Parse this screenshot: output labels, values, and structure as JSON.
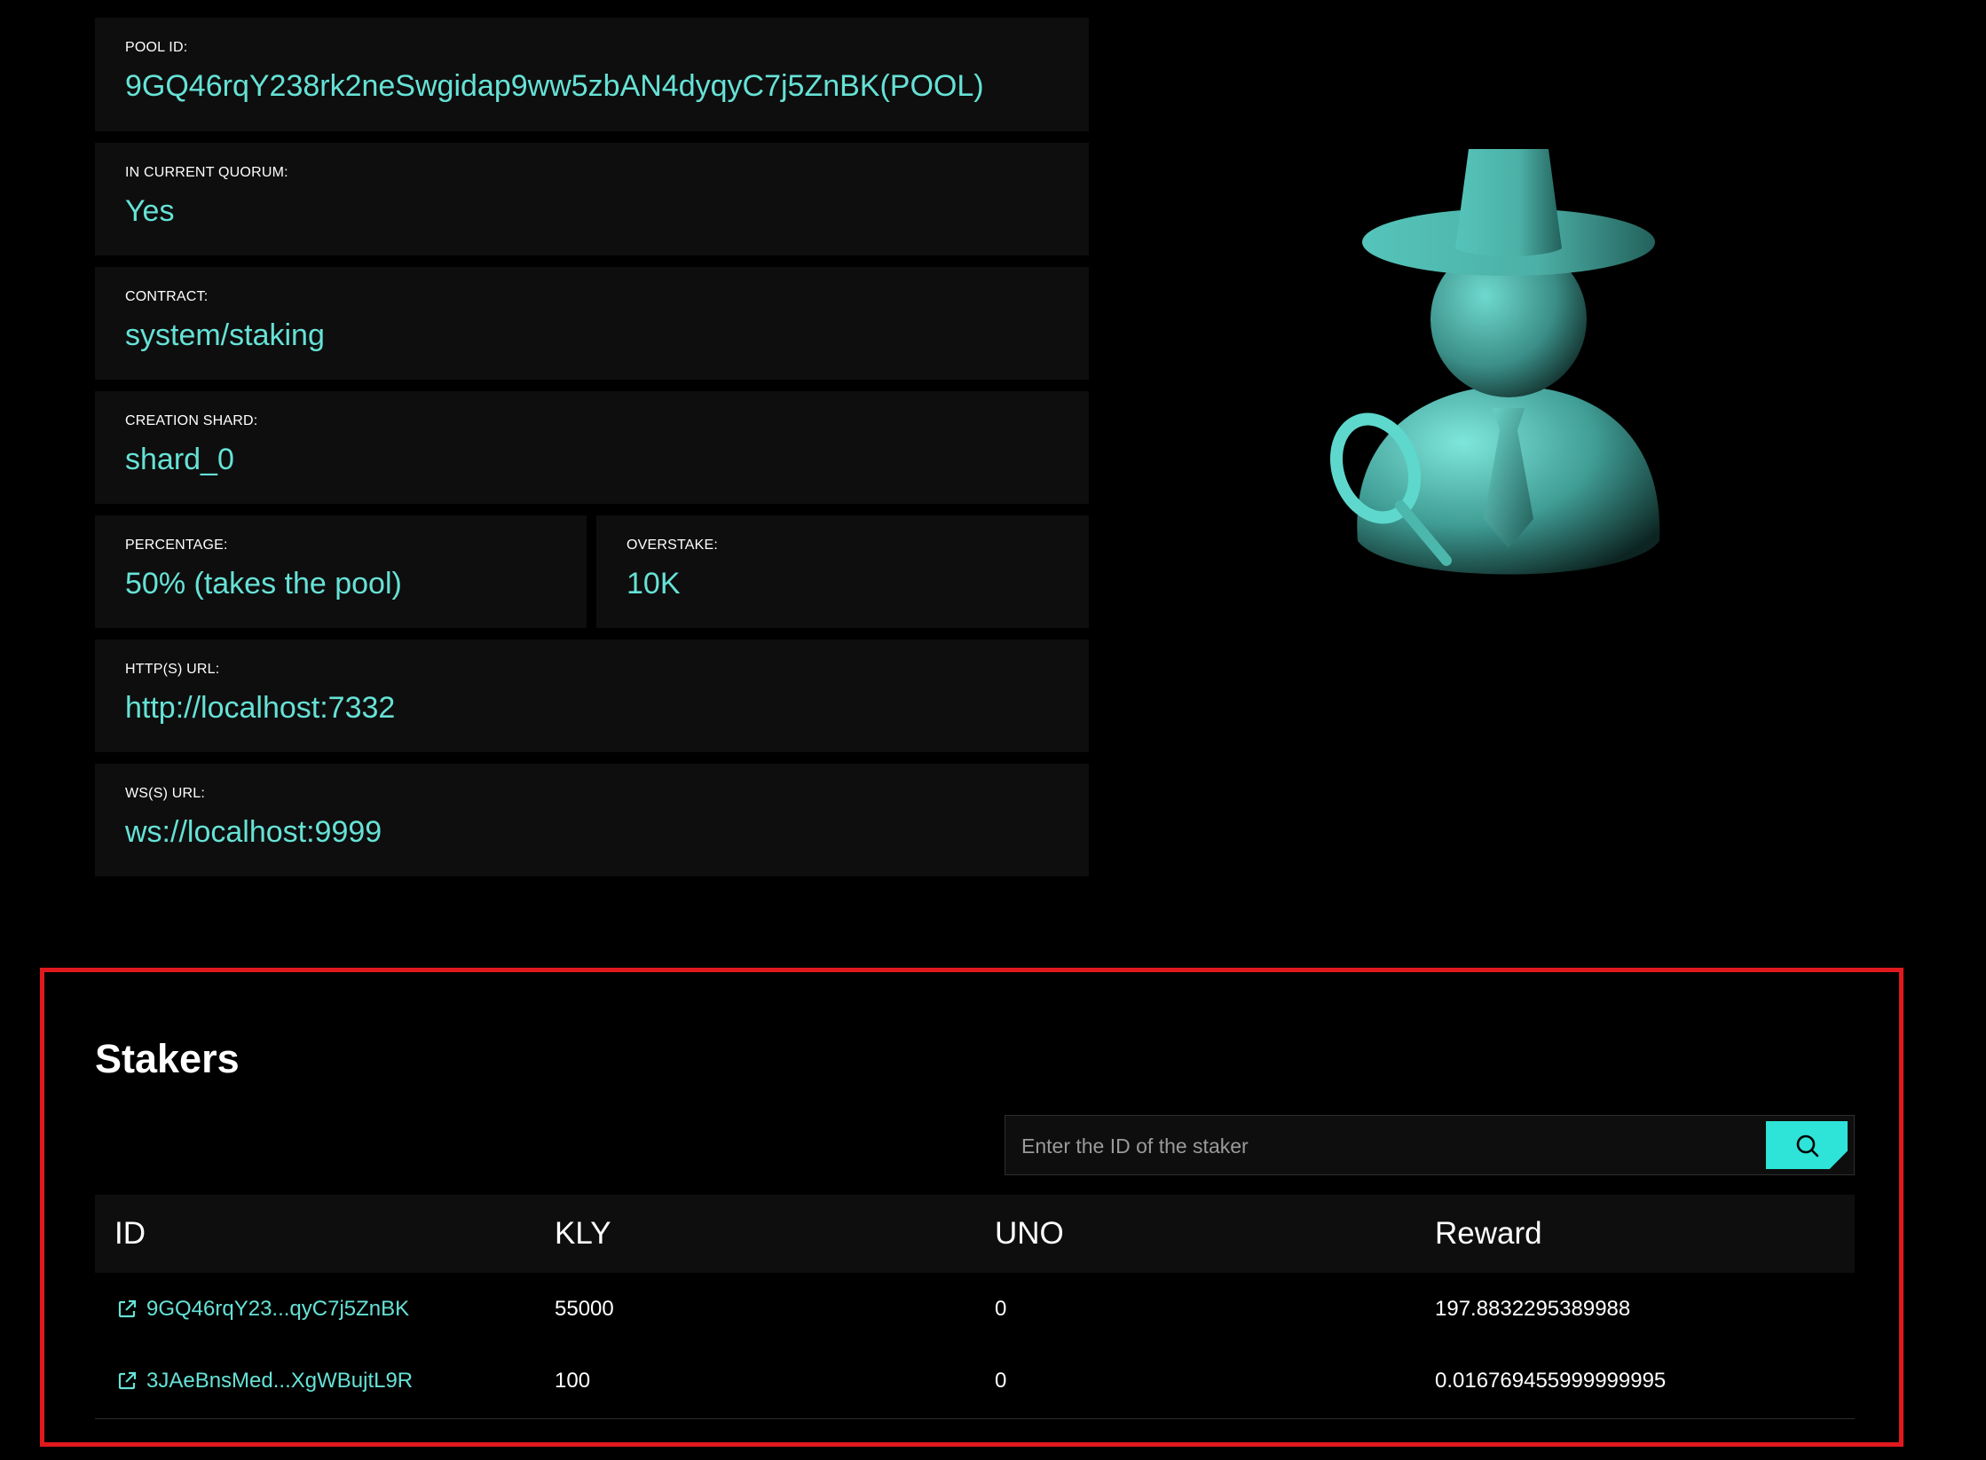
{
  "pool": {
    "pool_id": {
      "label": "POOL ID:",
      "value": "9GQ46rqY238rk2neSwgidap9ww5zbAN4dyqyC7j5ZnBK(POOL)"
    },
    "in_quorum": {
      "label": "IN CURRENT QUORUM:",
      "value": "Yes"
    },
    "contract": {
      "label": "CONTRACT:",
      "value": "system/staking"
    },
    "creation_shard": {
      "label": "CREATION SHARD:",
      "value": "shard_0"
    },
    "percentage": {
      "label": "PERCENTAGE:",
      "value": "50% (takes the pool)"
    },
    "overstake": {
      "label": "OVERSTAKE:",
      "value": "10K"
    },
    "http_url": {
      "label": "HTTP(S) URL:",
      "value": "http://localhost:7332"
    },
    "ws_url": {
      "label": "WS(S) URL:",
      "value": "ws://localhost:9999"
    }
  },
  "stakers": {
    "title": "Stakers",
    "search": {
      "placeholder": "Enter the ID of the staker",
      "icon": "search-icon"
    },
    "columns": [
      "ID",
      "KLY",
      "UNO",
      "Reward"
    ],
    "rows": [
      {
        "id": "9GQ46rqY23...qyC7j5ZnBK",
        "kly": "55000",
        "uno": "0",
        "reward": "197.8832295389988"
      },
      {
        "id": "3JAeBnsMed...XgWBujtL9R",
        "kly": "100",
        "uno": "0",
        "reward": "0.016769455999999995"
      }
    ]
  },
  "colors": {
    "accent": "#66e2d6",
    "button": "#2ee3d8",
    "card_bg": "#0e0e0e",
    "highlight_border": "#e0191f"
  }
}
